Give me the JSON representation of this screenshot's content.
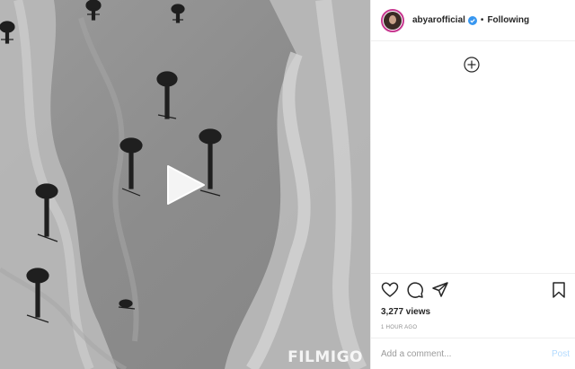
{
  "media": {
    "watermark": "FILMIGO",
    "play_icon": "play-icon",
    "tint": "#8f8f8f"
  },
  "header": {
    "username": "abyarofficial",
    "verified_icon": "verified-badge-icon",
    "separator": "•",
    "follow_state": "Following"
  },
  "comments": {
    "add_icon": "plus-circle-icon"
  },
  "actions": {
    "icons": [
      "heart-icon",
      "comment-icon",
      "share-icon",
      "bookmark-icon"
    ]
  },
  "stats": {
    "views": "3,277 views",
    "time": "1 HOUR AGO"
  },
  "comment_bar": {
    "placeholder": "Add a comment...",
    "post_label": "Post"
  },
  "colors": {
    "verified": "#3897f0",
    "avatar_ring": "#c7378f",
    "post_disabled": "#b3dbff",
    "text": "#262626",
    "muted": "#8e8e8e"
  }
}
